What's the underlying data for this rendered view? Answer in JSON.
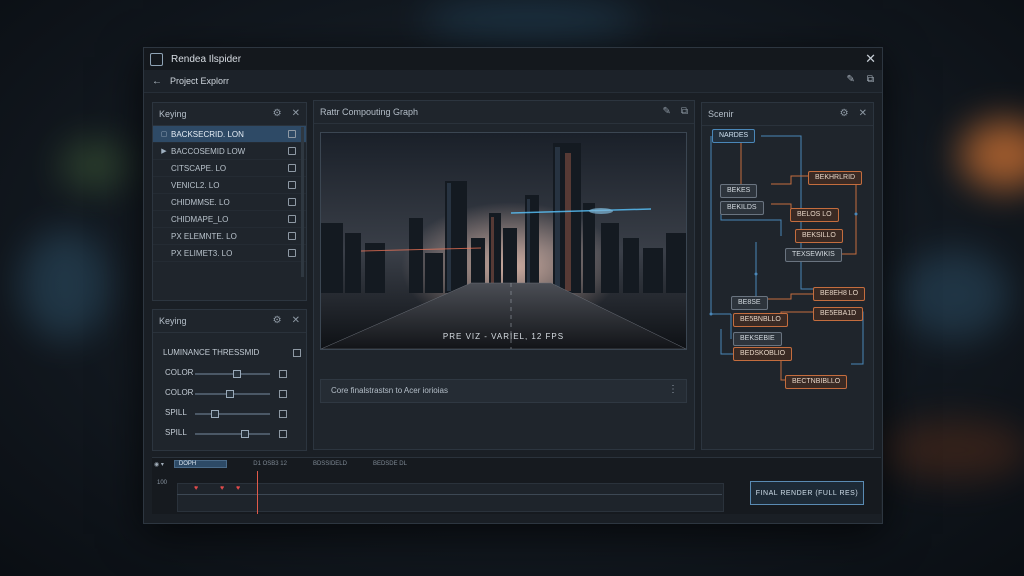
{
  "window": {
    "title": "Rendea Ilspider",
    "close": "✕"
  },
  "nav": {
    "back": "←",
    "title": "Project Explorr"
  },
  "layers_panel": {
    "title": "Keying",
    "items": [
      {
        "lead": "▢",
        "label": "BACKSECRID. LON",
        "selected": true
      },
      {
        "lead": "▶",
        "label": "BACCOSEMID LOW"
      },
      {
        "lead": "",
        "label": "CITSCAPE. LO"
      },
      {
        "lead": "",
        "label": "VENICL2. LO"
      },
      {
        "lead": "",
        "label": "CHIDMMSE. LO"
      },
      {
        "lead": "",
        "label": "CHIDMAPE_LO"
      },
      {
        "lead": "",
        "label": "PX ELEMNTE. LO"
      },
      {
        "lead": "",
        "label": "PX ELIMET3. LO"
      }
    ]
  },
  "keying_panel": {
    "title": "Keying",
    "section": "LUMINANCE THRESSMID",
    "rows": [
      {
        "label": "COLOR",
        "level": 0.55
      },
      {
        "label": "COLOR",
        "level": 0.45
      },
      {
        "label": "SPILL",
        "level": 0.25
      },
      {
        "label": "SPILL",
        "level": 0.65
      }
    ]
  },
  "viewer_panel": {
    "title": "Rattr   Compouting Graph",
    "caption": "PRE VIZ - VARIEL, 12 FPS",
    "info": "Core finalstrastsn to Acer iorioias"
  },
  "graph_panel": {
    "title": "Scenir",
    "nodes": [
      "NARDES",
      "BEKHRLRID",
      "BEKES",
      "BELOS LO",
      "BEKILDS",
      "BEKSILLO",
      "TEXSEWIKIS",
      "BE8SE",
      "BE8EH8 LO",
      "BE5BNBLLO",
      "BE5EBA1D",
      "BEKSEBIE",
      "BEDSKOBLIO",
      "BECTNBIBLLO"
    ]
  },
  "timeline": {
    "tabs": [
      "DOPH",
      "D1 OSB3 12",
      "BDSSIDELD",
      "BEDSDE DL"
    ],
    "frame": "100",
    "render_button": "FINAL RENDER (FULL RES)"
  },
  "colors": {
    "accent": "#4a87b8",
    "node_orange": "#c46d3e",
    "selection": "#2e4a66",
    "playhead": "#e05a4a"
  }
}
